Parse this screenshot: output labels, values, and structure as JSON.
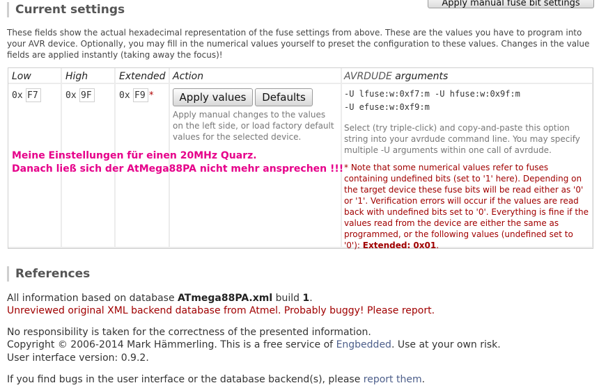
{
  "top_button": {
    "label": "Apply manual fuse bit settings"
  },
  "current_settings": {
    "title": "Current settings",
    "intro": "These fields show the actual hexadecimal representation of the fuse settings from above. These are the values you have to program into your AVR device. Optionally, you may fill in the numerical values yourself to preset the configuration to these values. Changes in the value fields are applied instantly (taking away the focus)!"
  },
  "table": {
    "headers": {
      "low": "Low",
      "high": "High",
      "extended": "Extended",
      "action": "Action",
      "avrdude_em": "AVRDUDE",
      "avrdude_rest": " arguments"
    },
    "prefix": "0x",
    "low_value": "F7",
    "high_value": "9F",
    "extended_value": "F9",
    "extended_marker": "*",
    "apply_label": "Apply values",
    "defaults_label": "Defaults",
    "action_hint": "Apply manual changes to the values on the left side, or load factory default values for the selected device.",
    "avrdude_line1": "-U lfuse:w:0xf7:m -U hfuse:w:0x9f:m",
    "avrdude_line2": "-U efuse:w:0xf9:m",
    "avrdude_help": "Select (try triple-click) and copy-and-paste this option string into your avrdude command line. You may specify multiple -U arguments within one call of avrdude.",
    "note_text": "* Note that some numerical values refer to fuses containing undefined bits (set to '1' here). Depending on the target device these fuse bits will be read either as '0' or '1'. Verification errors will occur if the values are read back with undefined bits set to '0'. Everything is fine if the values read from the device are either the same as programmed, or the following values (undefined set to '0'): ",
    "note_bold": "Extended: 0x01",
    "note_end": "."
  },
  "overlay": {
    "line1": "Meine Einstellungen für einen 20MHz Quarz.",
    "line2": "Danach ließ sich der AtMega88PA nicht mehr ansprechen !!!"
  },
  "references": {
    "title": "References",
    "db_prefix": "All information based on database ",
    "db_name": "ATmega88PA.xml",
    "db_build_prefix": " build ",
    "db_build": "1",
    "db_suffix": ".",
    "warning": "Unreviewed original XML backend database from Atmel. Probably buggy! Please report.",
    "responsibility": "No responsibility is taken for the correctness of the presented information.",
    "copyright_prefix": "Copyright © 2006-2014 Mark Hämmerling. This is a free service of ",
    "copyright_link": "Engbedded",
    "copyright_suffix": ". Use at your own risk.",
    "version": "User interface version: 0.9.2.",
    "bugs_prefix": "If you find bugs in the user interface or the database backend(s), please ",
    "bugs_link": "report them",
    "bugs_suffix": "."
  }
}
